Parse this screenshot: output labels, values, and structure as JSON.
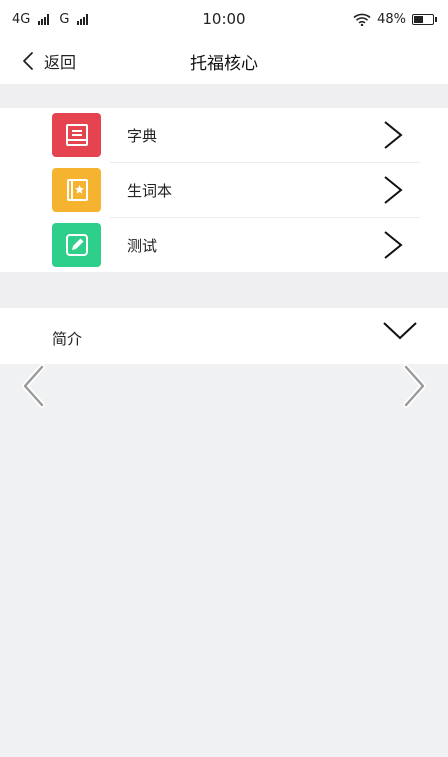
{
  "status_bar": {
    "network_1": "4G",
    "network_2": "G",
    "time": "10:00",
    "battery": "48%",
    "battery_level": 0.48
  },
  "nav": {
    "back_label": "返回",
    "title": "托福核心"
  },
  "menu": {
    "items": [
      {
        "label": "字典",
        "icon": "dictionary-book-icon",
        "color": "#e5434f"
      },
      {
        "label": "生词本",
        "icon": "vocabulary-notebook-icon",
        "color": "#f5b330"
      },
      {
        "label": "测试",
        "icon": "test-pencil-icon",
        "color": "#2ecf8a"
      }
    ]
  },
  "intro": {
    "label": "简介"
  },
  "colors": {
    "background": "#f0f1f3",
    "surface": "#ffffff",
    "text": "#222222"
  }
}
